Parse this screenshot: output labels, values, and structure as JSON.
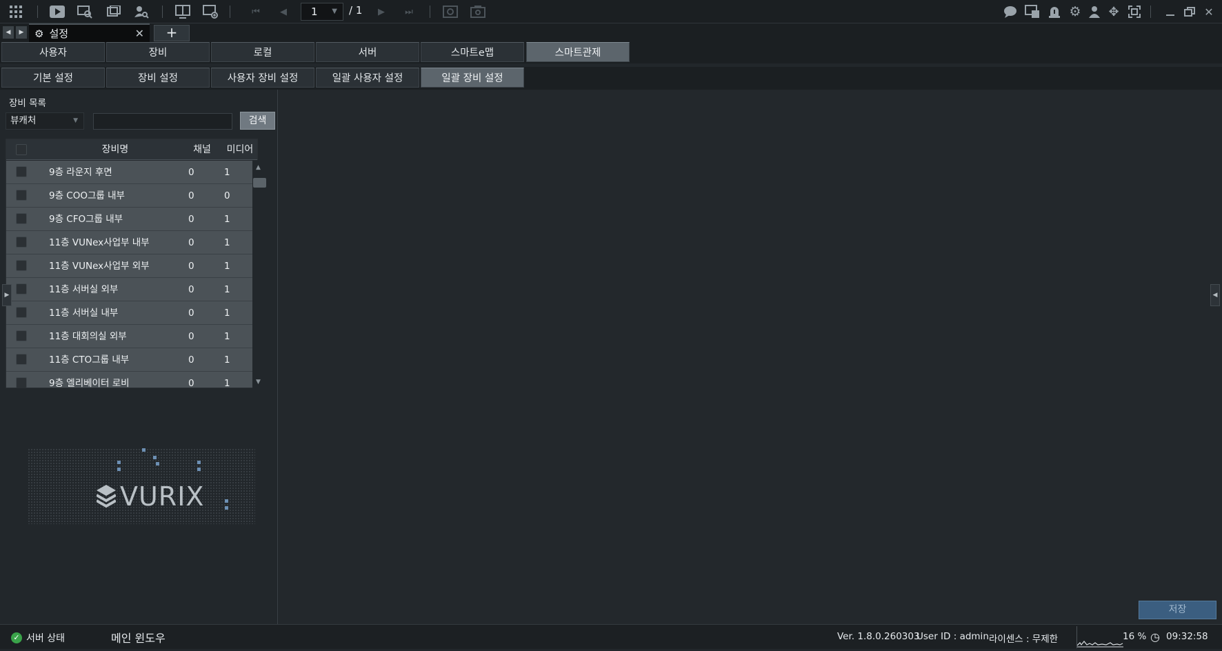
{
  "toolbar": {
    "current_page": "1",
    "page_total": "/ 1"
  },
  "tabs": {
    "active_label": "설정",
    "close": "✕",
    "add": "+"
  },
  "menu_tabs": [
    "사용자",
    "장비",
    "로컬",
    "서버",
    "스마트e맵",
    "스마트관제"
  ],
  "sub_tabs": [
    "기본 설정",
    "장비 설정",
    "사용자 장비 설정",
    "일괄 사용자 설정",
    "일괄 장비 설정"
  ],
  "device_list": {
    "label": "장비 목록",
    "filter_value": "뷰캐처",
    "search_value": "",
    "search_button": "검색",
    "columns": [
      "장비명",
      "채널",
      "미디어"
    ],
    "rows": [
      {
        "name": "9층 라운지 후면",
        "channel": "0",
        "media": "1"
      },
      {
        "name": "9층 COO그룹 내부",
        "channel": "0",
        "media": "0"
      },
      {
        "name": "9층 CFO그룹 내부",
        "channel": "0",
        "media": "1"
      },
      {
        "name": "11층 VUNex사업부 내부",
        "channel": "0",
        "media": "1"
      },
      {
        "name": "11층 VUNex사업부 외부",
        "channel": "0",
        "media": "1"
      },
      {
        "name": "11층 서버실 외부",
        "channel": "0",
        "media": "1"
      },
      {
        "name": "11층 서버실 내부",
        "channel": "0",
        "media": "1"
      },
      {
        "name": "11층 대회의실 외부",
        "channel": "0",
        "media": "1"
      },
      {
        "name": "11층 CTO그룹 내부",
        "channel": "0",
        "media": "1"
      },
      {
        "name": "9층 엘리베이터 로비",
        "channel": "0",
        "media": "1"
      }
    ]
  },
  "logo_text": "VURIX",
  "save_button": "저장",
  "status": {
    "server_state": "서버 상태",
    "main_window": "메인 윈도우",
    "version": "Ver. 1.8.0.260303",
    "user_id": "User ID : admin",
    "license": "라이센스 : 무제한",
    "cpu": "16 %",
    "time": "09:32:58"
  },
  "colors": {
    "accent_selected_tab": "#5c656c",
    "save_button": "#3b5e80",
    "status_ok": "#3aa34a"
  }
}
